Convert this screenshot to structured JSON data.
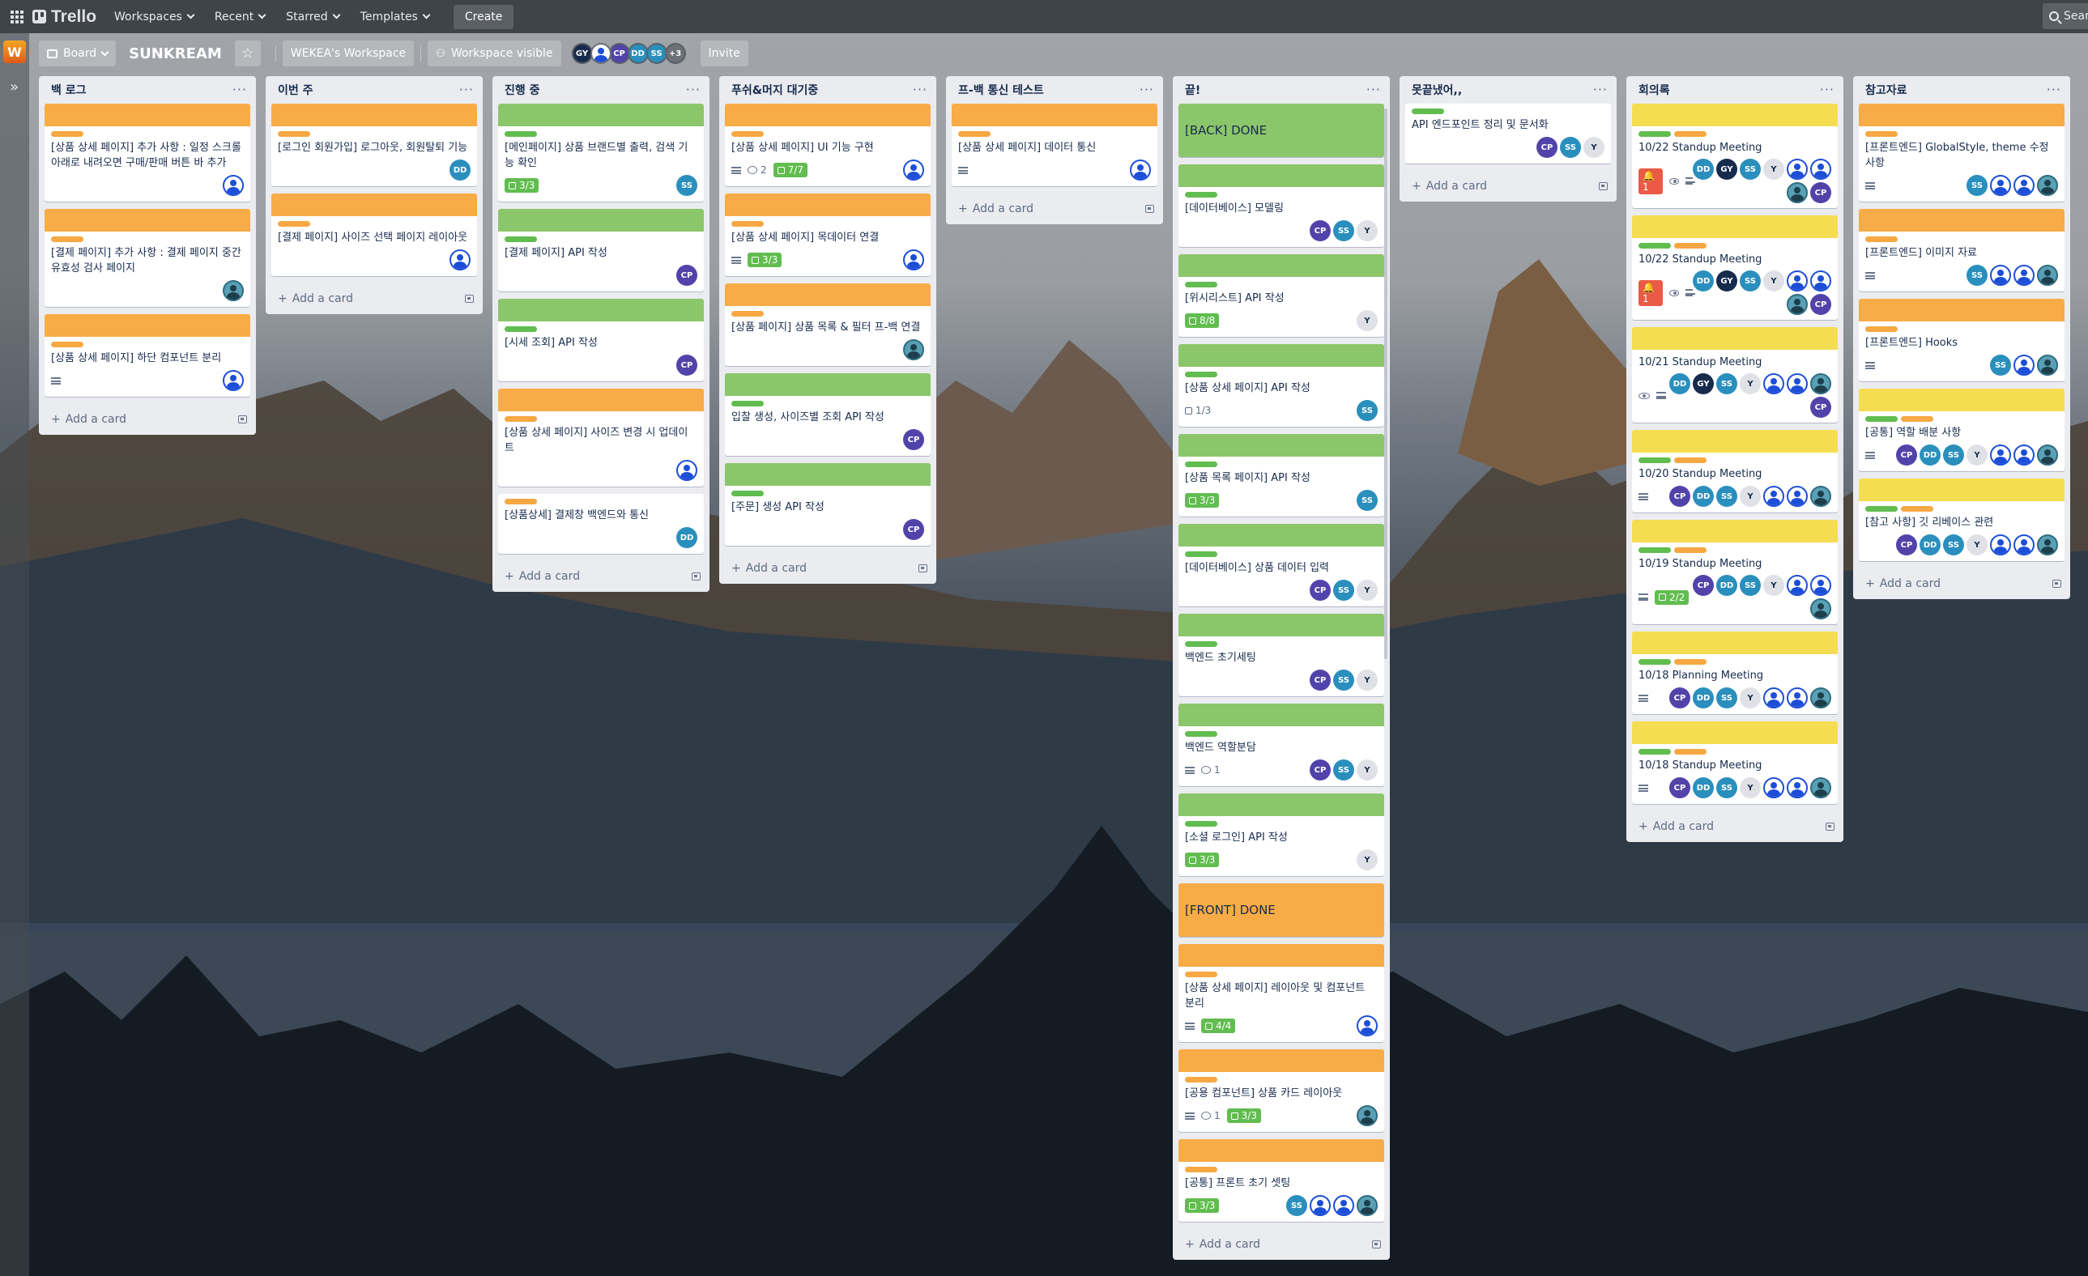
{
  "topnav": {
    "logo": "Trello",
    "workspaces": "Workspaces",
    "recent": "Recent",
    "starred": "Starred",
    "templates": "Templates",
    "create": "Create",
    "search": "Sear"
  },
  "sidebar": {
    "workspace_initial": "W"
  },
  "boardbar": {
    "view": "Board",
    "title": "SUNKREAM",
    "workspace": "WEKEA's Workspace",
    "visibility": "Workspace visible",
    "invite": "Invite",
    "more_members": "+3"
  },
  "colors": {
    "orange": "#f7ac47",
    "green": "#8cc66b",
    "yellow": "#f5dd51",
    "list_bg": "#ebecf0"
  },
  "add_card": "Add a card",
  "lists": [
    {
      "title": "백 로그",
      "cards": [
        {
          "labels": [
            "o"
          ],
          "title": "[상품 상세 페이지] 추가 사항 : 일정 스크롤 아래로 내려오면 구매/판매 버튼 바 추가",
          "avatars": [
            "p"
          ]
        },
        {
          "labels": [
            "o"
          ],
          "title": "[결제 페이지] 추가 사항 : 결제 페이지 중간 유효성 검사 페이지",
          "avatars": [
            "pt"
          ]
        },
        {
          "labels": [
            "o"
          ],
          "title": "[상품 상세 페이지] 하단 컴포넌트 분리",
          "desc": true,
          "avatars": [
            "p"
          ]
        }
      ]
    },
    {
      "title": "이번 주",
      "cards": [
        {
          "labels": [
            "o"
          ],
          "title": "[로그인 회원가입] 로그아웃, 회원탈퇴 기능",
          "avatars": [
            "dd"
          ]
        },
        {
          "labels": [
            "o"
          ],
          "title": "[결제 페이지] 사이즈 선택 페이지 레이아웃",
          "avatars": [
            "p"
          ]
        }
      ]
    },
    {
      "title": "진행 중",
      "cover": "green",
      "cards": [
        {
          "labels": [
            "g"
          ],
          "title": "[메인페이지] 상품 브랜드별 출력, 검색 기능 확인",
          "check": "3/3",
          "avatars": [
            "ss"
          ]
        },
        {
          "labels": [
            "g"
          ],
          "title": "[결제 페이지] API 작성",
          "avatars": [
            "cp"
          ]
        },
        {
          "labels": [
            "g"
          ],
          "title": "[시세 조회] API 작성",
          "avatars": [
            "cp"
          ]
        },
        {
          "cover": "orange",
          "labels": [
            "o"
          ],
          "title": "[상품 상세 페이지] 사이즈 변경 시 업데이트",
          "avatars": [
            "p"
          ]
        },
        {
          "cover": "none",
          "labels": [
            "o"
          ],
          "title": "[상품상세] 결제창 백엔드와 통신",
          "avatars": [
            "dd"
          ]
        }
      ]
    },
    {
      "title": "푸쉬&머지 대기중",
      "cards": [
        {
          "cover": "orange",
          "labels": [
            "o"
          ],
          "title": "[상품 상세 페이지] UI 기능 구현",
          "desc": true,
          "comments": "2",
          "check": "7/7",
          "avatars": [
            "p"
          ]
        },
        {
          "cover": "orange",
          "labels": [
            "o"
          ],
          "title": "[상품 상세 페이지] 목데이터 연결",
          "desc": true,
          "check": "3/3",
          "avatars": [
            "p"
          ]
        },
        {
          "cover": "orange",
          "labels": [
            "o"
          ],
          "title": "[상품 페이지] 상품 목록 & 필터 프-백 연결",
          "avatars": [
            "pt"
          ]
        },
        {
          "cover": "green",
          "labels": [
            "g"
          ],
          "title": "입찰 생성, 사이즈별 조회 API 작성",
          "avatars": [
            "cp"
          ]
        },
        {
          "cover": "green",
          "labels": [
            "g"
          ],
          "title": "[주문] 생성 API 작성",
          "avatars": [
            "cp"
          ]
        }
      ]
    },
    {
      "title": "프-백 통신 테스트",
      "cards": [
        {
          "cover": "orange",
          "labels": [
            "o"
          ],
          "title": "[상품 상세 페이지] 데이터 통신",
          "desc": true,
          "avatars": [
            "p"
          ]
        }
      ]
    },
    {
      "title": "끝!",
      "cards": [
        {
          "full": "green",
          "title": "[BACK] DONE"
        },
        {
          "cover": "green",
          "labels": [
            "g"
          ],
          "title": "[데이터베이스] 모델링",
          "avatars": [
            "cp",
            "ss",
            "y"
          ]
        },
        {
          "cover": "green",
          "labels": [
            "g"
          ],
          "title": "[위시리스트] API 작성",
          "check": "8/8",
          "avatars": [
            "y"
          ]
        },
        {
          "cover": "green",
          "labels": [
            "g"
          ],
          "title": "[상품 상세 페이지] API 작성",
          "checkplain": "1/3",
          "avatars": [
            "ss"
          ]
        },
        {
          "cover": "green",
          "labels": [
            "g"
          ],
          "title": "[상품 목록 페이지] API 작성",
          "check": "3/3",
          "avatars": [
            "ss"
          ]
        },
        {
          "cover": "green",
          "labels": [
            "g"
          ],
          "title": "[데이터베이스] 상품 데이터 입력",
          "avatars": [
            "cp",
            "ss",
            "y"
          ]
        },
        {
          "cover": "green",
          "labels": [
            "g"
          ],
          "title": "백엔드 초기세팅",
          "avatars": [
            "cp",
            "ss",
            "y"
          ]
        },
        {
          "cover": "green",
          "labels": [
            "g"
          ],
          "title": "백엔드 역할분담",
          "desc": true,
          "comments": "1",
          "avatars": [
            "cp",
            "ss",
            "y"
          ]
        },
        {
          "cover": "green",
          "labels": [
            "g"
          ],
          "title": "[소셜 로그인] API 작성",
          "check": "3/3",
          "avatars": [
            "y"
          ]
        },
        {
          "full": "orange",
          "title": "[FRONT] DONE"
        },
        {
          "cover": "orange",
          "labels": [
            "o"
          ],
          "title": "[상품 상세 페이지] 레이아웃 및 컴포넌트 분리",
          "desc": true,
          "check": "4/4",
          "avatars": [
            "p"
          ]
        },
        {
          "cover": "orange",
          "labels": [
            "o"
          ],
          "title": "[공용 컴포넌트] 상품 카드 레이아웃",
          "desc": true,
          "comments": "1",
          "check": "3/3",
          "avatars": [
            "pt"
          ]
        },
        {
          "cover": "orange",
          "labels": [
            "o"
          ],
          "title": "[공통] 프론트 초기 셋팅",
          "check": "3/3",
          "avatars": [
            "ss",
            "p",
            "p",
            "pt"
          ]
        }
      ]
    },
    {
      "title": "못끝냈어,,",
      "cards": [
        {
          "labels": [
            "g"
          ],
          "title": "API 엔드포인트 정리 및 문서화",
          "avatars": [
            "cp",
            "ss",
            "y"
          ]
        }
      ]
    },
    {
      "title": "회의록",
      "cards": [
        {
          "cover": "yellow",
          "labels": [
            "g",
            "o"
          ],
          "title": "10/22 Standup Meeting",
          "alert": "1",
          "eye": true,
          "desc": true,
          "avatars": [
            "dd",
            "gy",
            "ss",
            "y",
            "p",
            "p",
            "pt",
            "cp"
          ]
        },
        {
          "cover": "yellow",
          "labels": [
            "g",
            "o"
          ],
          "title": "10/22 Standup Meeting",
          "alert": "1",
          "eye": true,
          "desc": true,
          "avatars": [
            "dd",
            "gy",
            "ss",
            "y",
            "p",
            "p",
            "pt",
            "cp"
          ]
        },
        {
          "cover": "yellow",
          "labels": [],
          "title": "10/21 Standup Meeting",
          "eye": true,
          "desc": true,
          "avatars": [
            "dd",
            "gy",
            "ss",
            "y",
            "p",
            "p",
            "pt",
            "cp"
          ]
        },
        {
          "cover": "yellow",
          "labels": [
            "g",
            "o"
          ],
          "title": "10/20 Standup Meeting",
          "desc": true,
          "avatars": [
            "cp",
            "dd",
            "ss",
            "y",
            "p",
            "p",
            "pt"
          ]
        },
        {
          "cover": "yellow",
          "labels": [
            "g",
            "o"
          ],
          "title": "10/19 Standup Meeting",
          "desc": true,
          "check": "2/2",
          "avatars": [
            "cp",
            "dd",
            "ss",
            "y",
            "p",
            "p",
            "pt"
          ]
        },
        {
          "cover": "yellow",
          "labels": [
            "g",
            "o"
          ],
          "title": "10/18 Planning Meeting",
          "desc": true,
          "avatars": [
            "cp",
            "dd",
            "ss",
            "y",
            "p",
            "p",
            "pt"
          ]
        },
        {
          "cover": "yellow",
          "labels": [
            "g",
            "o"
          ],
          "title": "10/18 Standup Meeting",
          "desc": true,
          "avatars": [
            "cp",
            "dd",
            "ss",
            "y",
            "p",
            "p",
            "pt"
          ]
        }
      ]
    },
    {
      "title": "참고자료",
      "cards": [
        {
          "cover": "orange",
          "labels": [
            "o"
          ],
          "title": "[프론트엔드] GlobalStyle, theme 수정 사항",
          "desc": true,
          "avatars": [
            "ss",
            "p",
            "p",
            "pt"
          ]
        },
        {
          "cover": "orange",
          "labels": [
            "o"
          ],
          "title": "[프론트엔드] 이미지 자료",
          "desc": true,
          "avatars": [
            "ss",
            "p",
            "p",
            "pt"
          ]
        },
        {
          "cover": "orange",
          "labels": [
            "o"
          ],
          "title": "[프론트엔드] Hooks",
          "desc": true,
          "avatars": [
            "ss",
            "p",
            "pt"
          ]
        },
        {
          "cover": "yellow",
          "labels": [
            "g",
            "o"
          ],
          "title": "[공통] 역할 배분 사항",
          "desc": true,
          "avatars": [
            "cp",
            "dd",
            "ss",
            "y",
            "p",
            "p",
            "pt"
          ]
        },
        {
          "cover": "yellow",
          "labels": [
            "g",
            "o"
          ],
          "title": "[참고 사항] 깃 리베이스 관련",
          "avatars": [
            "cp",
            "dd",
            "ss",
            "y",
            "p",
            "p",
            "pt"
          ]
        }
      ]
    }
  ],
  "members": [
    "gy",
    "p",
    "cp",
    "dd",
    "ss"
  ]
}
